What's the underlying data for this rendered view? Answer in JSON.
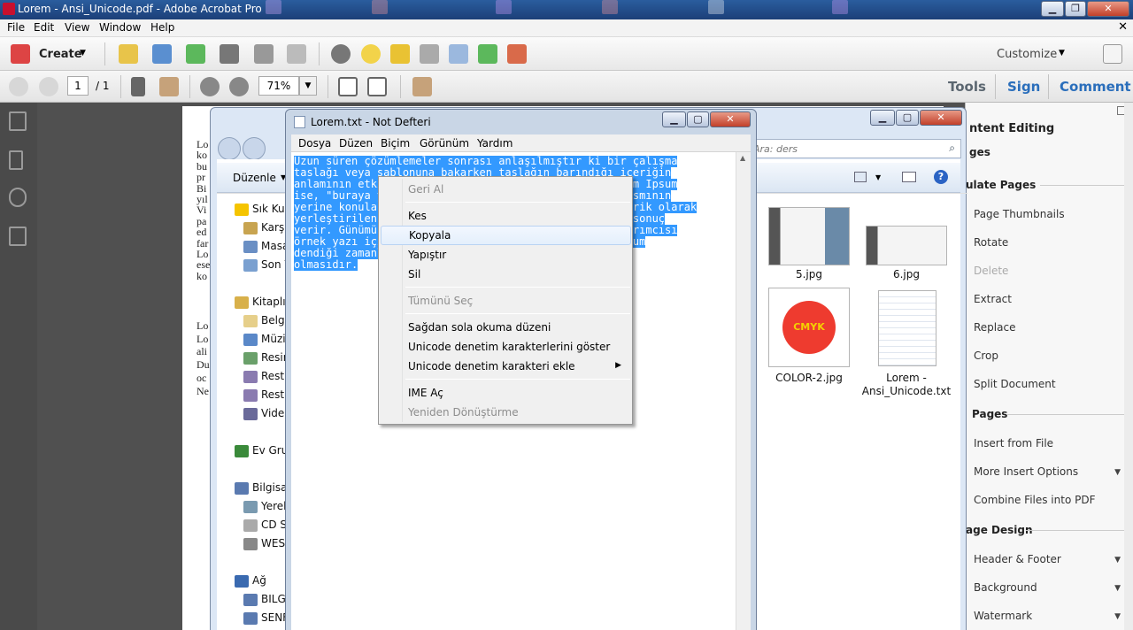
{
  "acrobat": {
    "window_title": "Lorem - Ansi_Unicode.pdf - Adobe Acrobat Pro",
    "menu": [
      "File",
      "Edit",
      "View",
      "Window",
      "Help"
    ],
    "create_label": "Create",
    "customize_label": "Customize",
    "page_number": "1",
    "page_total": "/ 1",
    "zoom": "71%",
    "tabs": [
      "Tools",
      "Sign",
      "Comment"
    ],
    "accent": "#2a6ebb"
  },
  "pdf_page": {
    "lines_a": [
      "Lo",
      "ko",
      "bu",
      "pr",
      "Bi",
      "yıl",
      "Vi",
      "pa",
      "ed",
      "far",
      "Lo",
      "ese",
      "ko"
    ],
    "lines_b": [
      "Lo",
      "Lo",
      "ali",
      "Du",
      "oc",
      "Ne"
    ]
  },
  "right_panel": {
    "section_title": "ntent Editing",
    "sub1": "ges",
    "group1": "ulate Pages",
    "items1": [
      {
        "label": "Page Thumbnails",
        "disabled": false
      },
      {
        "label": "Rotate",
        "disabled": false
      },
      {
        "label": "Delete",
        "disabled": true
      },
      {
        "label": "Extract",
        "disabled": false
      },
      {
        "label": "Replace",
        "disabled": false
      },
      {
        "label": "Crop",
        "disabled": false
      },
      {
        "label": "Split Document",
        "disabled": false
      }
    ],
    "group2": "Pages",
    "items2": [
      {
        "label": "Insert from File",
        "arrow": false
      },
      {
        "label": "More Insert Options",
        "arrow": true
      },
      {
        "label": "Combine Files into PDF",
        "arrow": false
      }
    ],
    "group3": "age Design",
    "items3": [
      {
        "label": "Header & Footer",
        "arrow": true
      },
      {
        "label": "Background",
        "arrow": true
      },
      {
        "label": "Watermark",
        "arrow": true
      }
    ]
  },
  "explorer": {
    "search_placeholder": "Ara: ders",
    "organize_label": "Düzenle",
    "nav": [
      {
        "label": "Sık Kul",
        "level": 0
      },
      {
        "label": "Karşı",
        "level": 1
      },
      {
        "label": "Masa",
        "level": 1
      },
      {
        "label": "Son Y",
        "level": 1
      },
      {
        "label": "Kitaplık",
        "level": 0
      },
      {
        "label": "Belge",
        "level": 1
      },
      {
        "label": "Müzi",
        "level": 1
      },
      {
        "label": "Resin",
        "level": 1
      },
      {
        "label": "Rest",
        "level": 1
      },
      {
        "label": "Rest",
        "level": 1
      },
      {
        "label": "Vide",
        "level": 1
      },
      {
        "label": "Ev Grul",
        "level": 0
      },
      {
        "label": "Bilgisay",
        "level": 0
      },
      {
        "label": "Yerel",
        "level": 1
      },
      {
        "label": "CD S",
        "level": 1
      },
      {
        "label": "WEST",
        "level": 1
      },
      {
        "label": "Ağ",
        "level": 0
      },
      {
        "label": "BILGI",
        "level": 1
      },
      {
        "label": "SENF",
        "level": 1
      }
    ],
    "files": [
      {
        "name": "5.jpg"
      },
      {
        "name": "6.jpg"
      },
      {
        "name": "COLOR-2.jpg",
        "badge": "CMYK"
      },
      {
        "name": "Lorem -",
        "name2": "Ansi_Unicode.txt"
      }
    ]
  },
  "notepad": {
    "title": "Lorem.txt - Not Defteri",
    "menu": [
      "Dosya",
      "Düzen",
      "Biçim",
      "Görünüm",
      "Yardım"
    ],
    "lines": [
      "Uzun süren çözümlemeler sonrası anlaşılmıştır ki bir çalışma",
      "taslağı veya şablonuna bakarken taslağın barındığı içeriğin",
      "anlamının etkilemesi yüzünden okuyucunun dikkati Lorem Ipsum",
      "ise, \"buraya yazı gelecek, buraya da yazı gelecek\" kısmının",
      "yerine konulan ve okunabilir bir dil gibi görünen içerik olarak",
      "yerleştirilen metin tamamıyla doğal bir dil gibi bir sonuç",
      "verir. Günümüzde çoğu masaüstü yayıncılık ve web tasarımcısı",
      "örnek yazı için Lorem Ipsum kullanır. Lorem Ipsum ipsum",
      "dendiği zamanlarda bir çok web sitesi ortaya çıkacek",
      "olmasıdır."
    ],
    "selection_color": "#3399ff"
  },
  "context_menu": {
    "items": [
      {
        "label": "Geri Al",
        "disabled": true
      },
      {
        "sep": true
      },
      {
        "label": "Kes",
        "disabled": false
      },
      {
        "label": "Kopyala",
        "disabled": false,
        "hover": true
      },
      {
        "label": "Yapıştır",
        "disabled": false
      },
      {
        "label": "Sil",
        "disabled": false
      },
      {
        "sep": true
      },
      {
        "label": "Tümünü Seç",
        "disabled": true
      },
      {
        "sep": true
      },
      {
        "label": "Sağdan sola okuma düzeni",
        "disabled": false
      },
      {
        "label": "Unicode denetim karakterlerini göster",
        "disabled": false
      },
      {
        "label": "Unicode denetim karakteri ekle",
        "disabled": false,
        "submenu": true
      },
      {
        "sep": true
      },
      {
        "label": "IME Aç",
        "disabled": false
      },
      {
        "label": "Yeniden Dönüştürme",
        "disabled": true
      }
    ]
  }
}
